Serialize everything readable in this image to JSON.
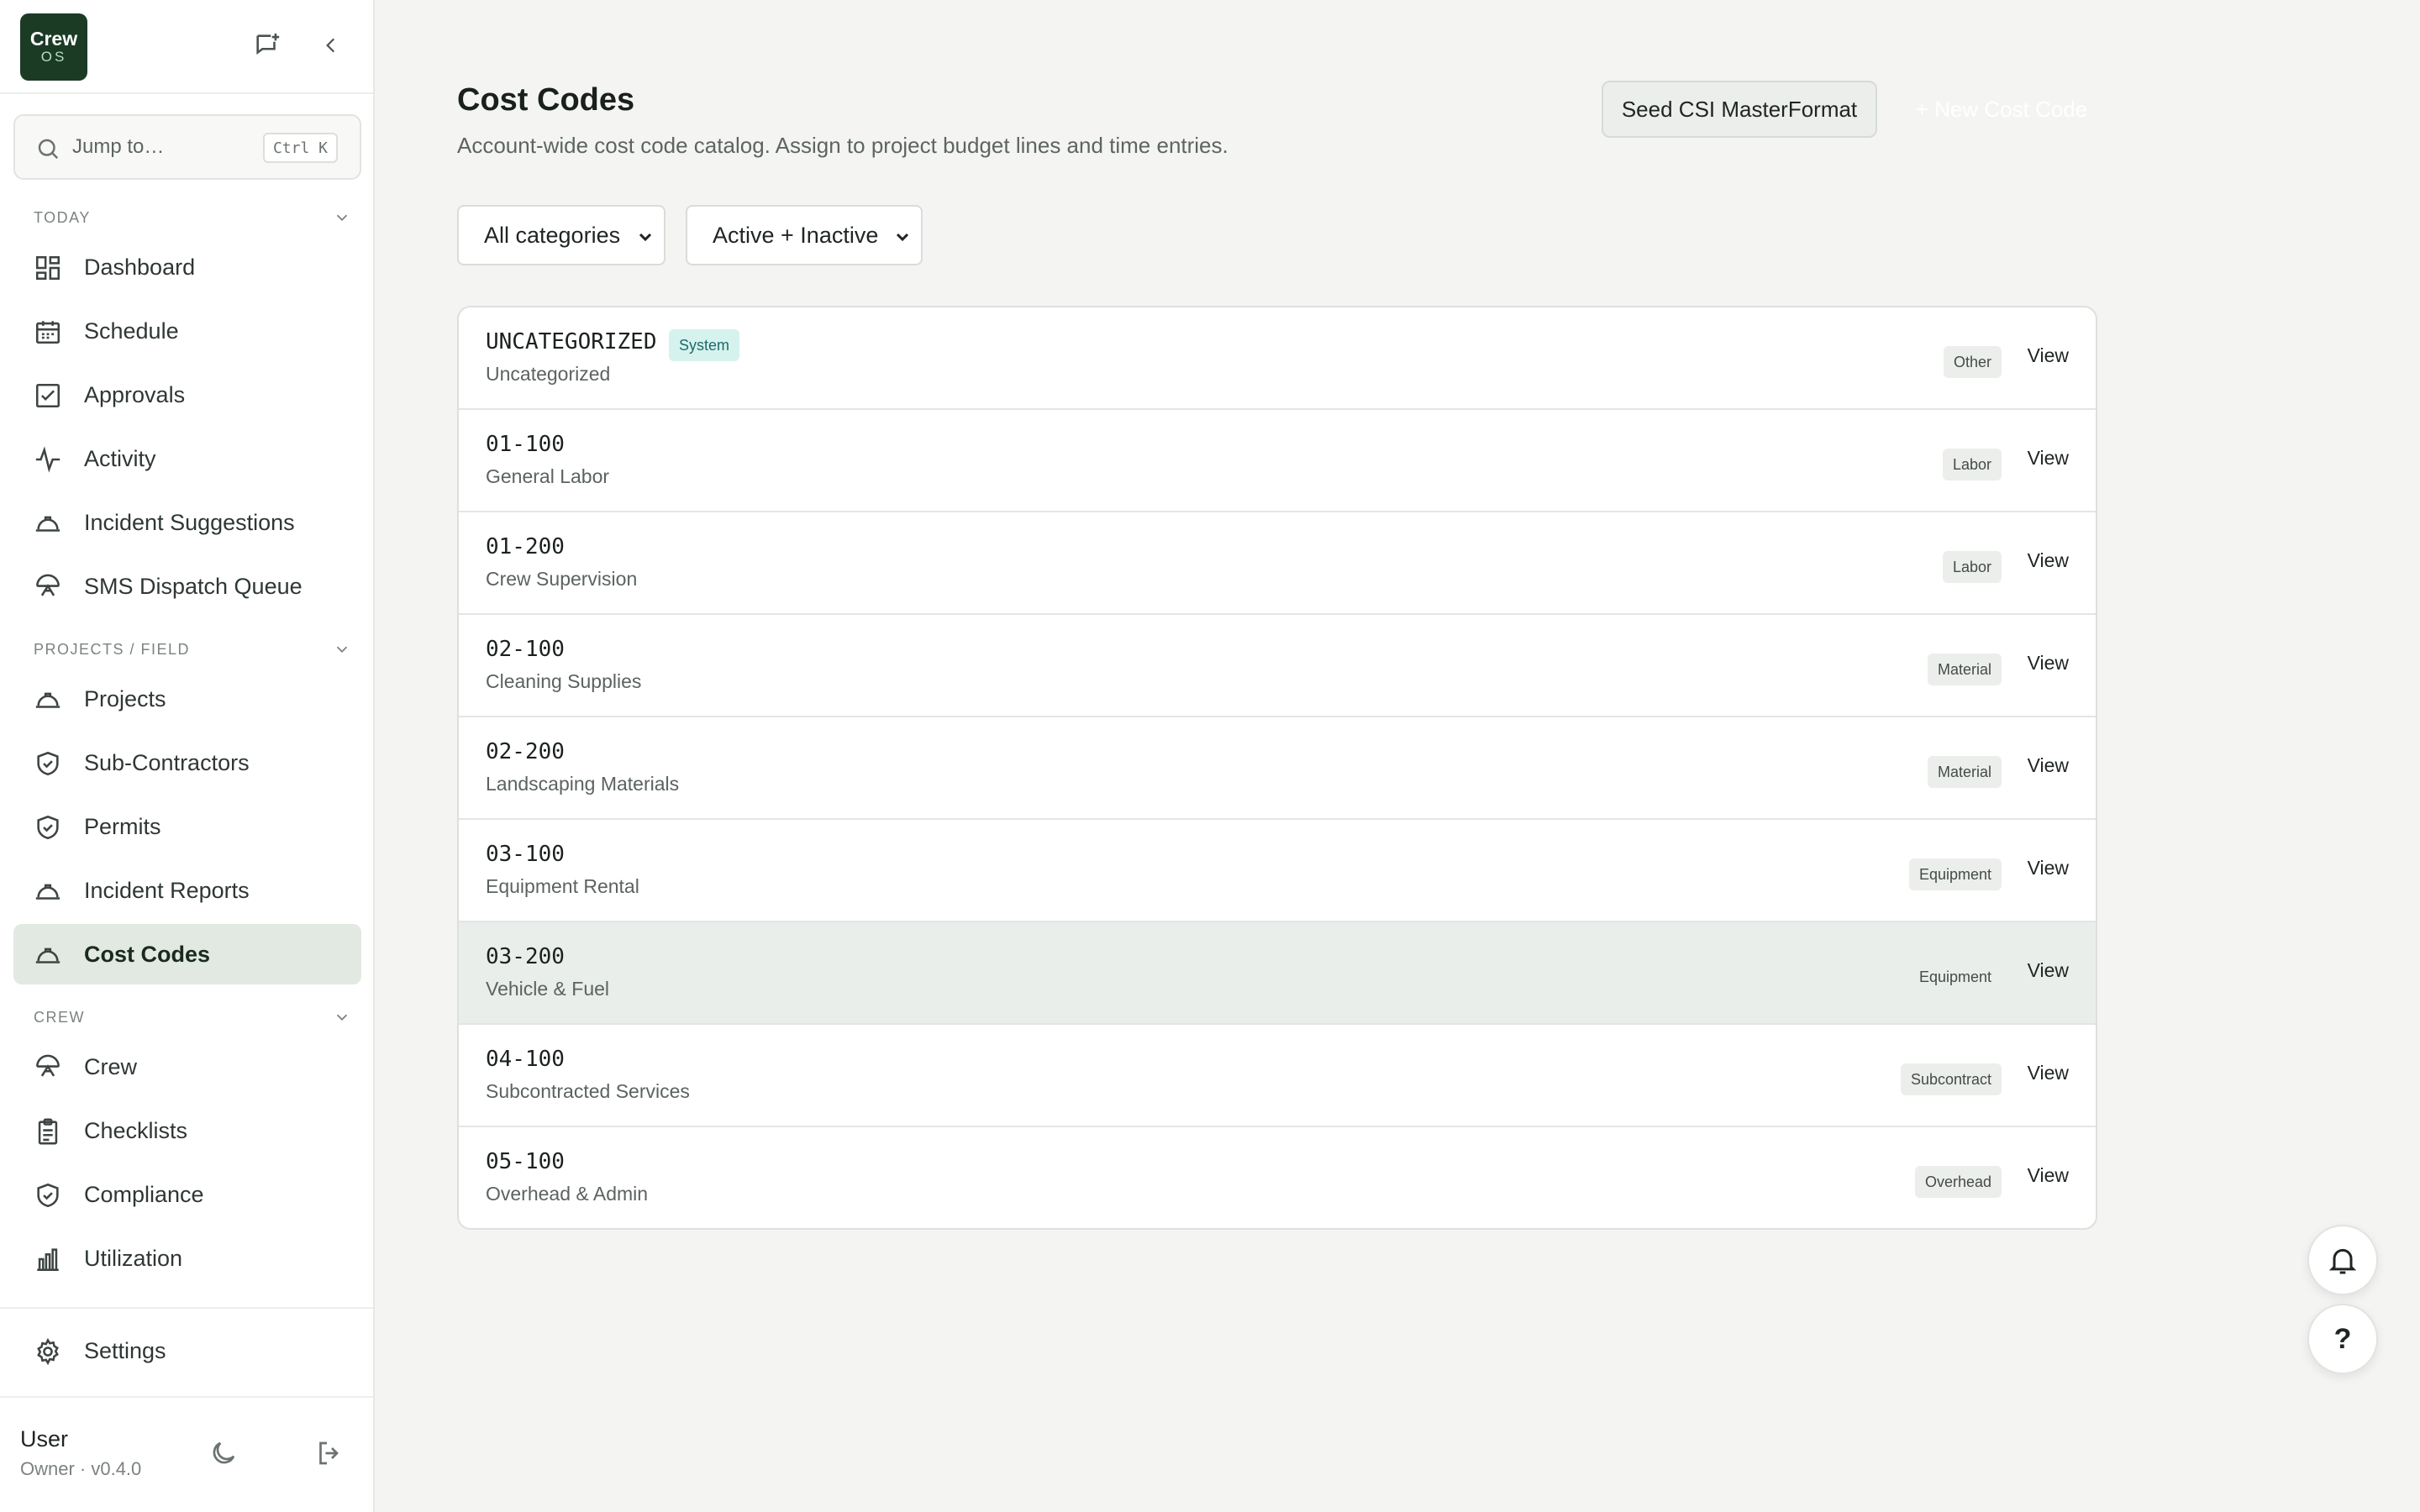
{
  "brand": {
    "line1": "Crew",
    "line2": "OS"
  },
  "search": {
    "placeholder": "Jump to…",
    "shortcut": "Ctrl K"
  },
  "sidebar": {
    "sections": [
      {
        "title": "TODAY",
        "items": [
          {
            "label": "Dashboard",
            "icon": "dashboard-icon"
          },
          {
            "label": "Schedule",
            "icon": "calendar-icon"
          },
          {
            "label": "Approvals",
            "icon": "checkbox-icon"
          },
          {
            "label": "Activity",
            "icon": "activity-icon"
          },
          {
            "label": "Incident Suggestions",
            "icon": "hardhat-icon"
          },
          {
            "label": "SMS Dispatch Queue",
            "icon": "dispatch-icon"
          }
        ]
      },
      {
        "title": "PROJECTS / FIELD",
        "items": [
          {
            "label": "Projects",
            "icon": "hardhat-icon"
          },
          {
            "label": "Sub-Contractors",
            "icon": "shield-icon"
          },
          {
            "label": "Permits",
            "icon": "shield-icon"
          },
          {
            "label": "Incident Reports",
            "icon": "hardhat-icon"
          },
          {
            "label": "Cost Codes",
            "icon": "hardhat-icon",
            "active": true
          }
        ]
      },
      {
        "title": "CREW",
        "items": [
          {
            "label": "Crew",
            "icon": "dispatch-icon"
          },
          {
            "label": "Checklists",
            "icon": "clipboard-icon"
          },
          {
            "label": "Compliance",
            "icon": "shield-icon"
          },
          {
            "label": "Utilization",
            "icon": "bar-chart-icon"
          }
        ]
      }
    ],
    "settings_label": "Settings",
    "user": {
      "name": "User",
      "subtitle": "Owner · v0.4.0"
    }
  },
  "page": {
    "title": "Cost Codes",
    "subtitle": "Account-wide cost code catalog. Assign to project budget lines and time entries.",
    "seed_button": "Seed CSI MasterFormat",
    "new_button": "+ New Cost Code",
    "filters": {
      "category": "All categories",
      "status": "Active + Inactive"
    }
  },
  "cost_codes": [
    {
      "code": "UNCATEGORIZED",
      "name": "Uncategorized",
      "category": "Other",
      "badge": "System",
      "view": "View"
    },
    {
      "code": "01-100",
      "name": "General Labor",
      "category": "Labor",
      "view": "View"
    },
    {
      "code": "01-200",
      "name": "Crew Supervision",
      "category": "Labor",
      "view": "View"
    },
    {
      "code": "02-100",
      "name": "Cleaning Supplies",
      "category": "Material",
      "view": "View"
    },
    {
      "code": "02-200",
      "name": "Landscaping Materials",
      "category": "Material",
      "view": "View"
    },
    {
      "code": "03-100",
      "name": "Equipment Rental",
      "category": "Equipment",
      "view": "View"
    },
    {
      "code": "03-200",
      "name": "Vehicle & Fuel",
      "category": "Equipment",
      "view": "View",
      "highlighted": true
    },
    {
      "code": "04-100",
      "name": "Subcontracted Services",
      "category": "Subcontract",
      "view": "View"
    },
    {
      "code": "05-100",
      "name": "Overhead & Admin",
      "category": "Overhead",
      "view": "View"
    }
  ],
  "help_label": "?",
  "colors": {
    "brand": "#1b3b25",
    "active_nav": "#e2e9e2",
    "system_badge": "#d6f2ef"
  }
}
